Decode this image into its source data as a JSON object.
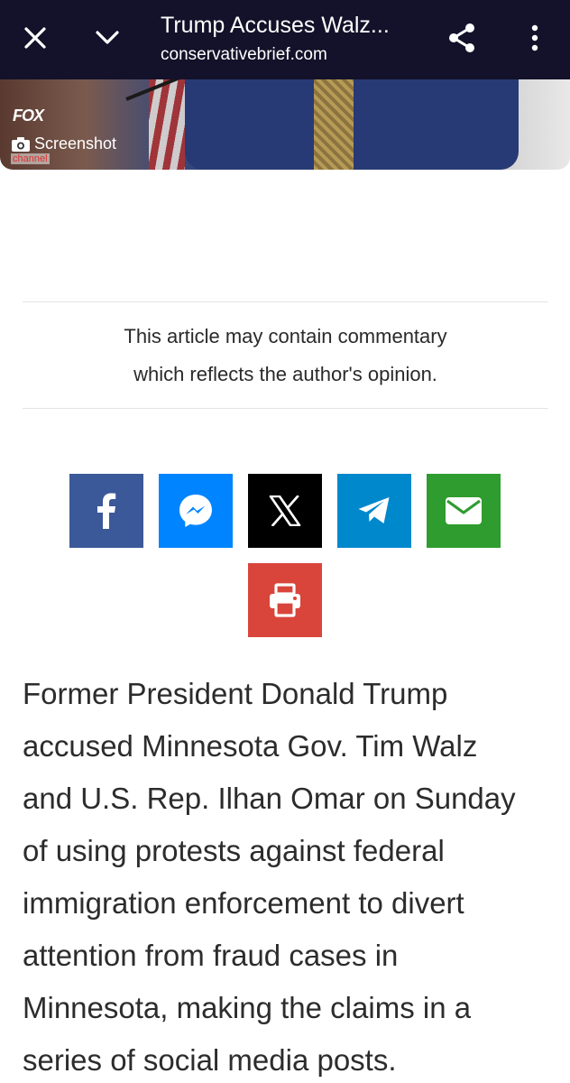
{
  "browser": {
    "title": "Trump Accuses Walz...",
    "url": "conservativebrief.com",
    "icons": [
      "close-icon",
      "chevron-down-icon",
      "share-icon",
      "more-vert-icon"
    ]
  },
  "hero": {
    "logo_text": "FOX",
    "logo_channel": "channel",
    "screenshot_label": "Screenshot"
  },
  "notice": {
    "line1": "This article may contain commentary",
    "line2": "which reflects the author's opinion."
  },
  "share_buttons": {
    "colors": {
      "facebook": "#3b5998",
      "messenger": "#0084ff",
      "x": "#000000",
      "telegram": "#0088cc",
      "email": "#2e9c2e",
      "print": "#d9453b"
    },
    "icons": [
      "facebook-icon",
      "messenger-icon",
      "x-icon",
      "telegram-icon",
      "email-icon",
      "print-icon"
    ]
  },
  "article": {
    "lines": [
      "Former President Donald Trump",
      "accused Minnesota Gov. Tim Walz",
      "and U.S. Rep. Ilhan Omar on Sunday",
      "of using protests against federal",
      "immigration enforcement to divert",
      "attention from fraud cases in",
      "Minnesota, making the claims in a",
      "series of social media posts."
    ]
  }
}
